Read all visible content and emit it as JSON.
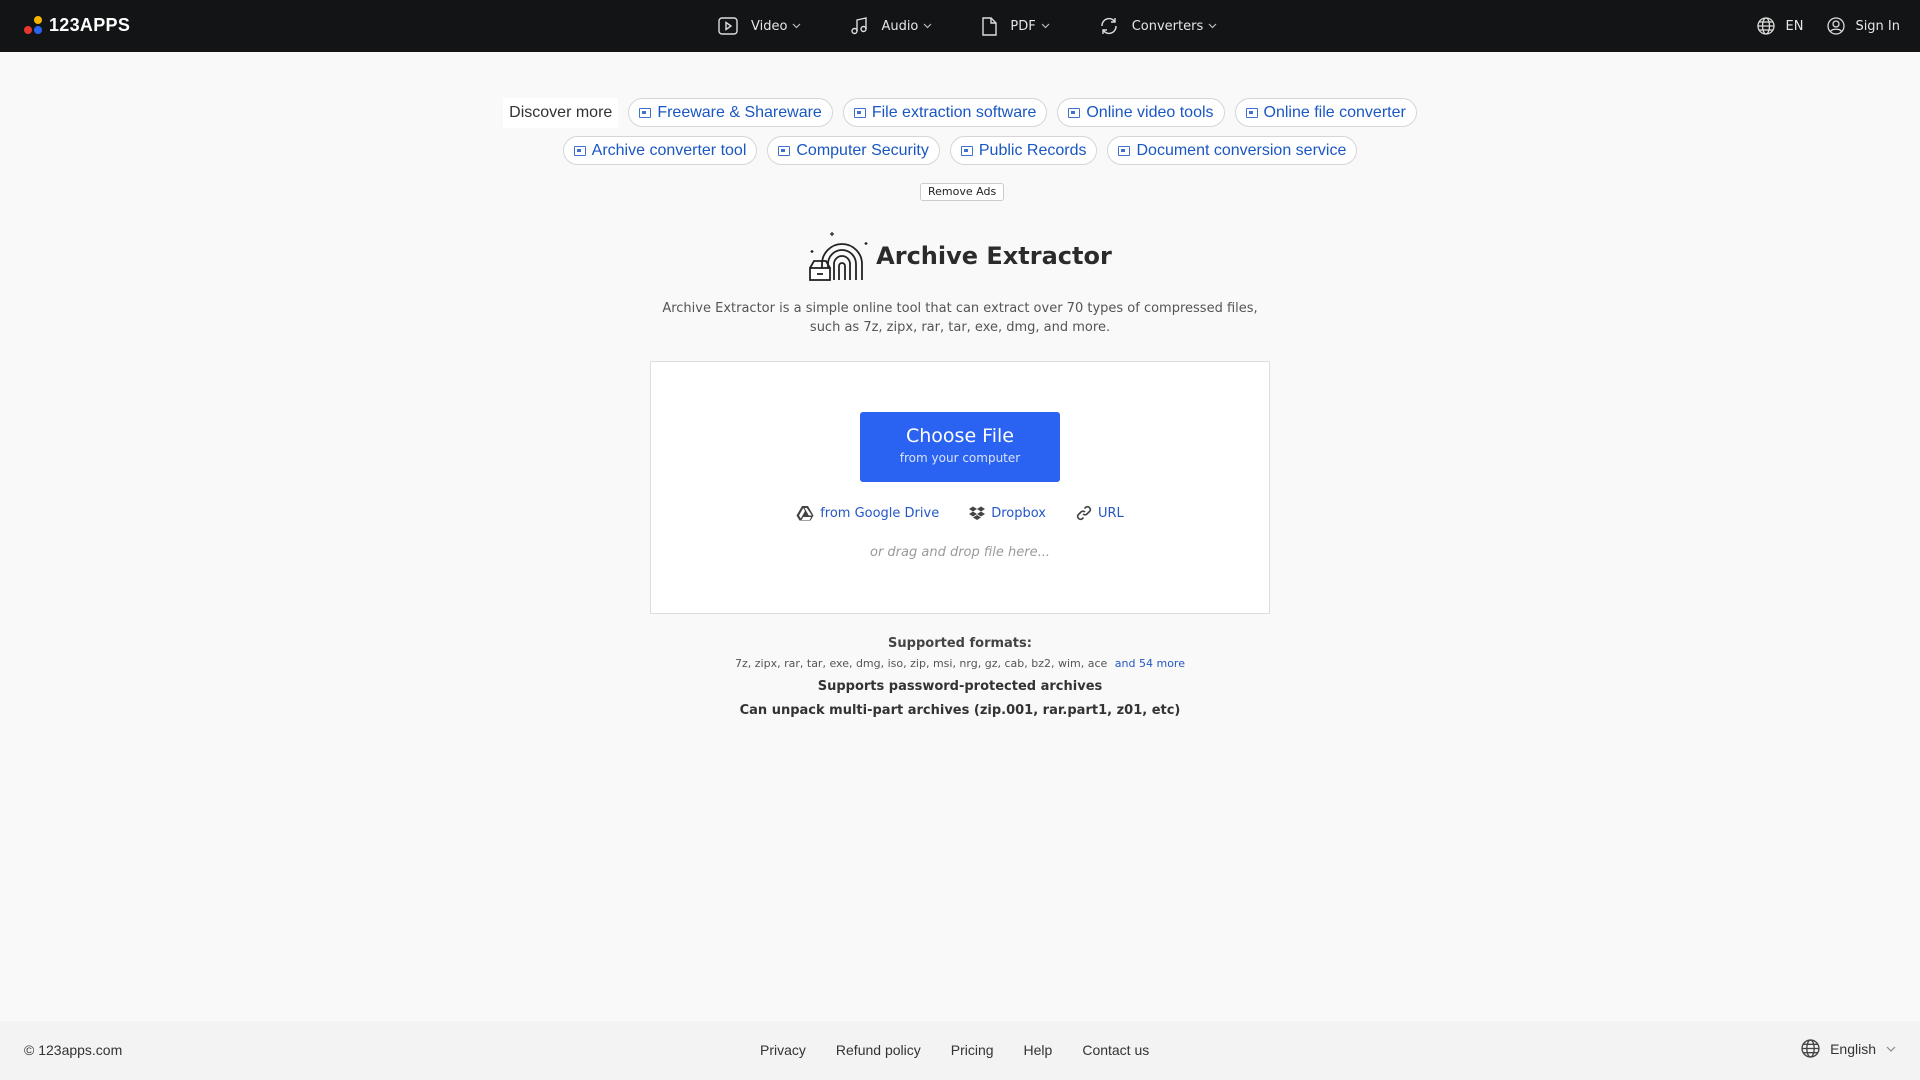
{
  "brand": {
    "logo_text": "123APPS",
    "colors": {
      "dot_yellow": "#f5b400",
      "dot_red": "#e5382d",
      "dot_blue": "#2a62f2"
    }
  },
  "nav": {
    "items": [
      {
        "label": "Video",
        "icon": "video-icon"
      },
      {
        "label": "Audio",
        "icon": "music-note-icon"
      },
      {
        "label": "PDF",
        "icon": "document-icon"
      },
      {
        "label": "Converters",
        "icon": "refresh-icon"
      }
    ],
    "language": "EN",
    "sign_in": "Sign In"
  },
  "discover": {
    "label": "Discover more",
    "links_row1": [
      "Freeware & Shareware",
      "File extraction software",
      "Online video tools",
      "Online file converter"
    ],
    "links_row2": [
      "Archive converter tool",
      "Computer Security",
      "Public Records",
      "Document conversion service"
    ]
  },
  "remove_ads": "Remove Ads",
  "tool": {
    "title": "Archive Extractor",
    "description_line1": "Archive Extractor is a simple online tool that can extract over 70 types of compressed files,",
    "description_line2": "such as 7z, zipx, rar, tar, exe, dmg, and more."
  },
  "upload": {
    "choose_label": "Choose File",
    "choose_sub": "from your computer",
    "google_drive": "from Google Drive",
    "dropbox": "Dropbox",
    "url": "URL",
    "drop_hint": "or drag and drop file here...",
    "accent": "#2a62f2"
  },
  "formats": {
    "title": "Supported formats:",
    "list": "7z, zipx, rar, tar, exe, dmg, iso, zip, msi, nrg, gz, cab, bz2, wim, ace",
    "more": "and 54 more",
    "note1": "Supports password-protected archives",
    "note2": "Can unpack multi-part archives (zip.001, rar.part1, z01, etc)"
  },
  "footer": {
    "copyright": "© 123apps.com",
    "links": [
      "Privacy",
      "Refund policy",
      "Pricing",
      "Help",
      "Contact us"
    ],
    "language": "English"
  }
}
